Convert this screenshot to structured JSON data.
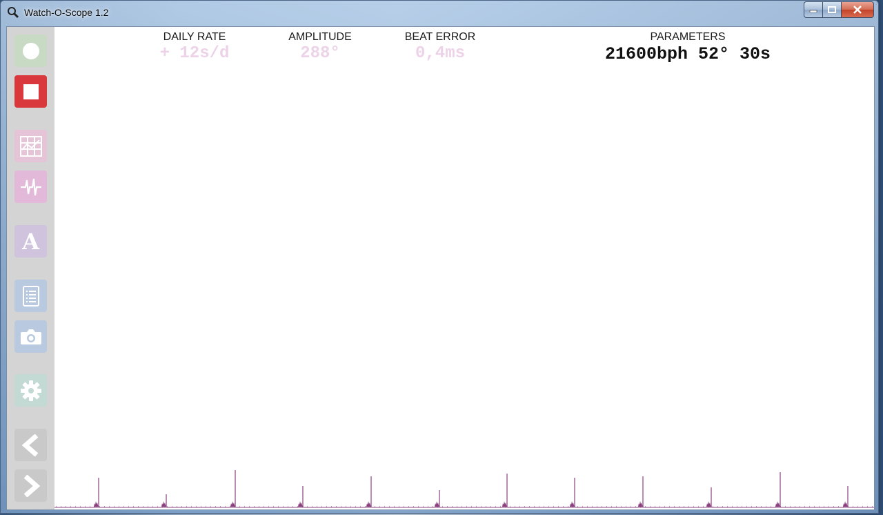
{
  "window": {
    "title": "Watch-O-Scope 1.2"
  },
  "sidebar": {
    "buttons": [
      {
        "name": "record-button",
        "icon": "circle-icon",
        "color": "#c9dac4"
      },
      {
        "name": "stop-button",
        "icon": "stop-square-icon",
        "color": "#d9393c"
      },
      {
        "name": "grid-view-button",
        "icon": "grid-chart-icon",
        "color": "#e6c4d8"
      },
      {
        "name": "waveform-view-button",
        "icon": "waveform-icon",
        "color": "#e2b9d8"
      },
      {
        "name": "amplitude-button",
        "icon": "letter-a-icon",
        "color": "#d0c3dd"
      },
      {
        "name": "report-button",
        "icon": "document-list-icon",
        "color": "#b9c9df"
      },
      {
        "name": "snapshot-button",
        "icon": "camera-icon",
        "color": "#b9c9df"
      },
      {
        "name": "settings-button",
        "icon": "gear-icon",
        "color": "#c2d9d4"
      },
      {
        "name": "back-button",
        "icon": "chevron-left-icon",
        "color": "#c9c9c9"
      },
      {
        "name": "forward-button",
        "icon": "chevron-right-icon",
        "color": "#c9c9c9"
      }
    ],
    "letter_a": "A"
  },
  "metrics": {
    "daily_rate": {
      "label": "DAILY RATE",
      "value": "+ 12s/d"
    },
    "amplitude": {
      "label": "AMPLITUDE",
      "value": "288°"
    },
    "beat_error": {
      "label": "BEAT ERROR",
      "value": "0,4ms"
    },
    "parameters": {
      "label": "PARAMETERS",
      "value": "21600bph 52° 30s"
    }
  },
  "colors": {
    "trace": "#8a3f7e",
    "faded_value": "#ecd3e8",
    "accent_stop": "#d9393c"
  }
}
